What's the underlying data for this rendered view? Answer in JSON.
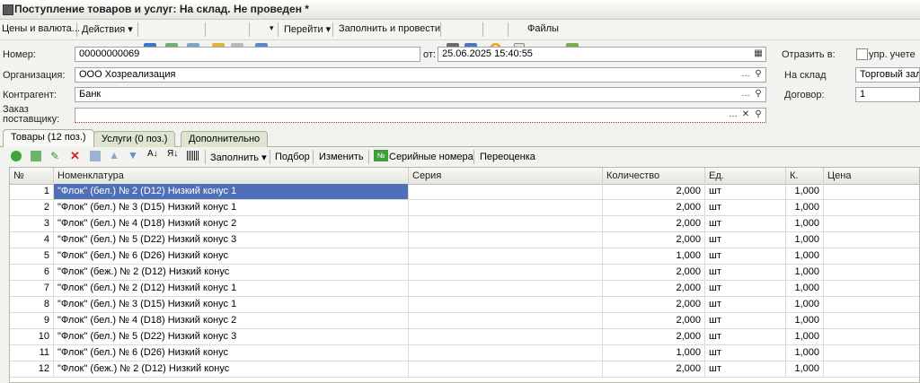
{
  "window": {
    "title": "Поступление товаров и услуг: На склад. Не проведен *"
  },
  "toolbar": {
    "prices_label": "Цены и валюта...",
    "actions_label": "Действия",
    "goto_label": "Перейти",
    "fill_post_label": "Заполнить и провести",
    "files_label": "Файлы"
  },
  "form": {
    "number_label": "Номер:",
    "number_value": "00000000069",
    "date_label": "от:",
    "date_value": "25.06.2025 15:40:55",
    "org_label": "Организация:",
    "org_value": "ООО Хозреализация",
    "contractor_label": "Контрагент:",
    "contractor_value": "Банк",
    "order_label_1": "Заказ",
    "order_label_2": "поставщику:",
    "order_value": "",
    "reflect_label": "Отразить в:",
    "mgmt_label": "упр. учете",
    "warehouse_label": "На склад",
    "warehouse_value": "Торговый зал",
    "contract_label": "Договор:",
    "contract_value": "1"
  },
  "tabs": [
    {
      "label": "Товары (12 поз.)"
    },
    {
      "label": "Услуги (0 поз.)"
    },
    {
      "label": "Дополнительно"
    }
  ],
  "table_toolbar": {
    "fill_label": "Заполнить",
    "pick_label": "Подбор",
    "change_label": "Изменить",
    "serial_label": "Серийные номера",
    "reval_label": "Переоценка"
  },
  "table": {
    "columns": [
      "№",
      "Номенклатура",
      "Серия",
      "Количество",
      "Ед.",
      "К.",
      "Цена"
    ],
    "rows": [
      [
        "1",
        "\"Флок\" (бел.) № 2 (D12) Низкий конус 1",
        "",
        "2,000",
        "шт",
        "1,000"
      ],
      [
        "2",
        "\"Флок\" (бел.) № 3 (D15) Низкий конус 1",
        "",
        "2,000",
        "шт",
        "1,000"
      ],
      [
        "3",
        "\"Флок\" (бел.) № 4 (D18) Низкий конус 2",
        "",
        "2,000",
        "шт",
        "1,000"
      ],
      [
        "4",
        "\"Флок\" (бел.) № 5 (D22) Низкий конус 3",
        "",
        "2,000",
        "шт",
        "1,000"
      ],
      [
        "5",
        "\"Флок\" (бел.) № 6 (D26) Низкий конус",
        "",
        "1,000",
        "шт",
        "1,000"
      ],
      [
        "6",
        "\"Флок\" (беж.) № 2 (D12) Низкий конус",
        "",
        "2,000",
        "шт",
        "1,000"
      ],
      [
        "7",
        "\"Флок\" (бел.) № 2 (D12) Низкий конус 1",
        "",
        "2,000",
        "шт",
        "1,000"
      ],
      [
        "8",
        "\"Флок\" (бел.) № 3 (D15) Низкий конус 1",
        "",
        "2,000",
        "шт",
        "1,000"
      ],
      [
        "9",
        "\"Флок\" (бел.) № 4 (D18) Низкий конус 2",
        "",
        "2,000",
        "шт",
        "1,000"
      ],
      [
        "10",
        "\"Флок\" (бел.) № 5 (D22) Низкий конус 3",
        "",
        "2,000",
        "шт",
        "1,000"
      ],
      [
        "11",
        "\"Флок\" (бел.) № 6 (D26) Низкий конус",
        "",
        "1,000",
        "шт",
        "1,000"
      ],
      [
        "12",
        "\"Флок\" (беж.) № 2 (D12) Низкий конус",
        "",
        "2,000",
        "шт",
        "1,000"
      ]
    ]
  }
}
